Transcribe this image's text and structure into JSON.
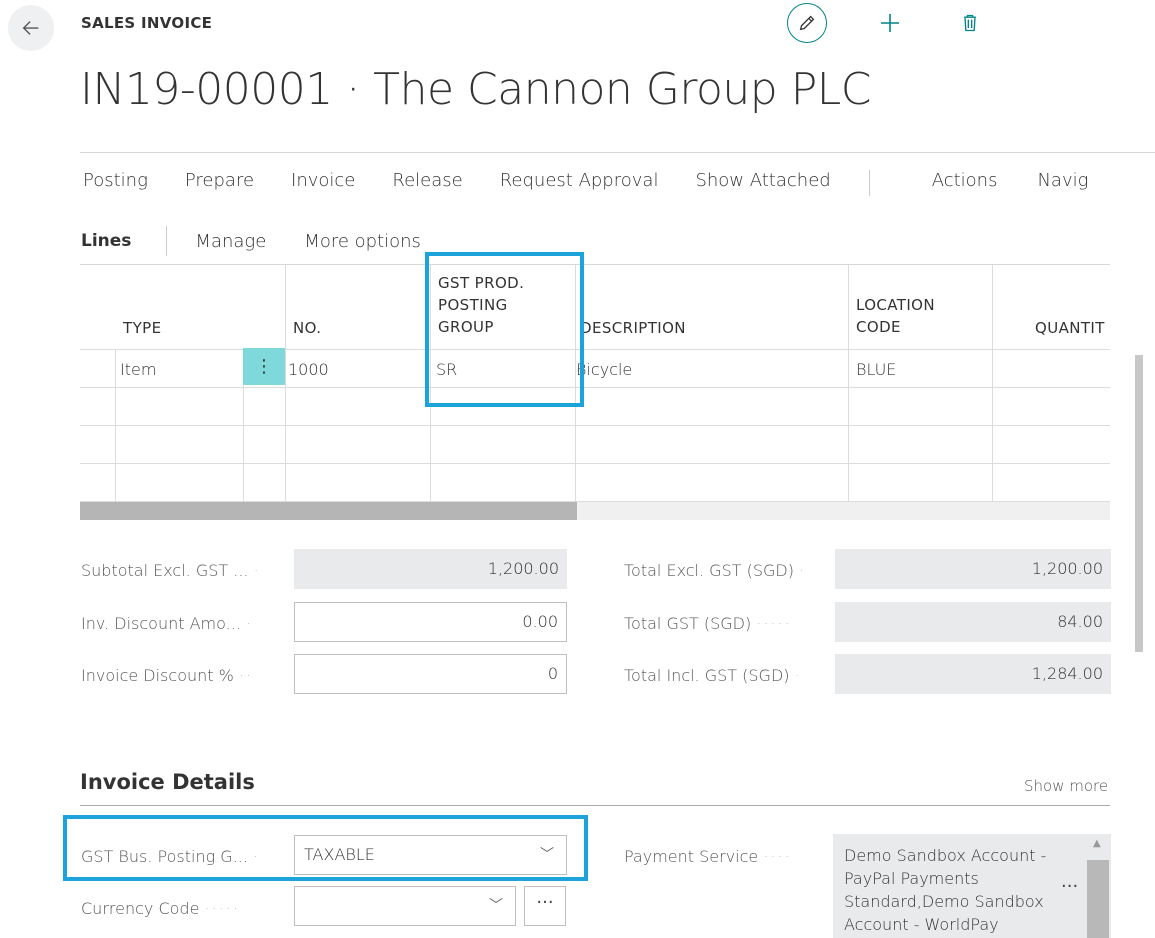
{
  "header": {
    "page_type": "SALES INVOICE",
    "title": "IN19-00001 · The Cannon Group PLC"
  },
  "icons": {
    "back": "arrow-left-icon",
    "edit": "pencil-icon",
    "add": "plus-icon",
    "delete": "trash-icon"
  },
  "actions": [
    "Posting",
    "Prepare",
    "Invoice",
    "Release",
    "Request Approval",
    "Show Attached",
    "Actions",
    "Navig"
  ],
  "lines_tabs": {
    "lines": "Lines",
    "manage": "Manage",
    "more": "More options"
  },
  "grid": {
    "columns": {
      "type": "TYPE",
      "no": "NO.",
      "gst_line1": "GST PROD.",
      "gst_line2": "POSTING",
      "gst_line3": "GROUP",
      "description": "DESCRIPTION",
      "loc_line1": "LOCATION",
      "loc_line2": "CODE",
      "quantity": "QUANTIT"
    },
    "rows": [
      {
        "type": "Item",
        "menu": "⋮",
        "no": "1000",
        "gst": "SR",
        "description": "Bicycle",
        "location": "BLUE"
      }
    ]
  },
  "totals": {
    "subtotal_label": "Subtotal Excl. GST ...",
    "subtotal_value": "1,200.00",
    "inv_disc_amt_label": "Inv. Discount Amo...",
    "inv_disc_amt_value": "0.00",
    "inv_disc_pct_label": "Invoice Discount %",
    "inv_disc_pct_value": "0",
    "total_excl_label": "Total Excl. GST (SGD)",
    "total_excl_value": "1,200.00",
    "total_gst_label": "Total GST (SGD)",
    "total_gst_value": "84.00",
    "total_incl_label": "Total Incl. GST (SGD)",
    "total_incl_value": "1,284.00"
  },
  "details": {
    "section_title": "Invoice Details",
    "show_more": "Show more",
    "gst_bus_label": "GST Bus. Posting G...",
    "gst_bus_value": "TAXABLE",
    "currency_label": "Currency Code",
    "currency_value": "",
    "payment_label": "Payment Service",
    "payment_value": "Demo Sandbox Account - PayPal Payments Standard,Demo Sandbox Account - WorldPay",
    "ellipsis": "···"
  },
  "colors": {
    "accent": "#008489",
    "highlight": "#1ca3dc",
    "row_select": "#7fd8d9"
  }
}
